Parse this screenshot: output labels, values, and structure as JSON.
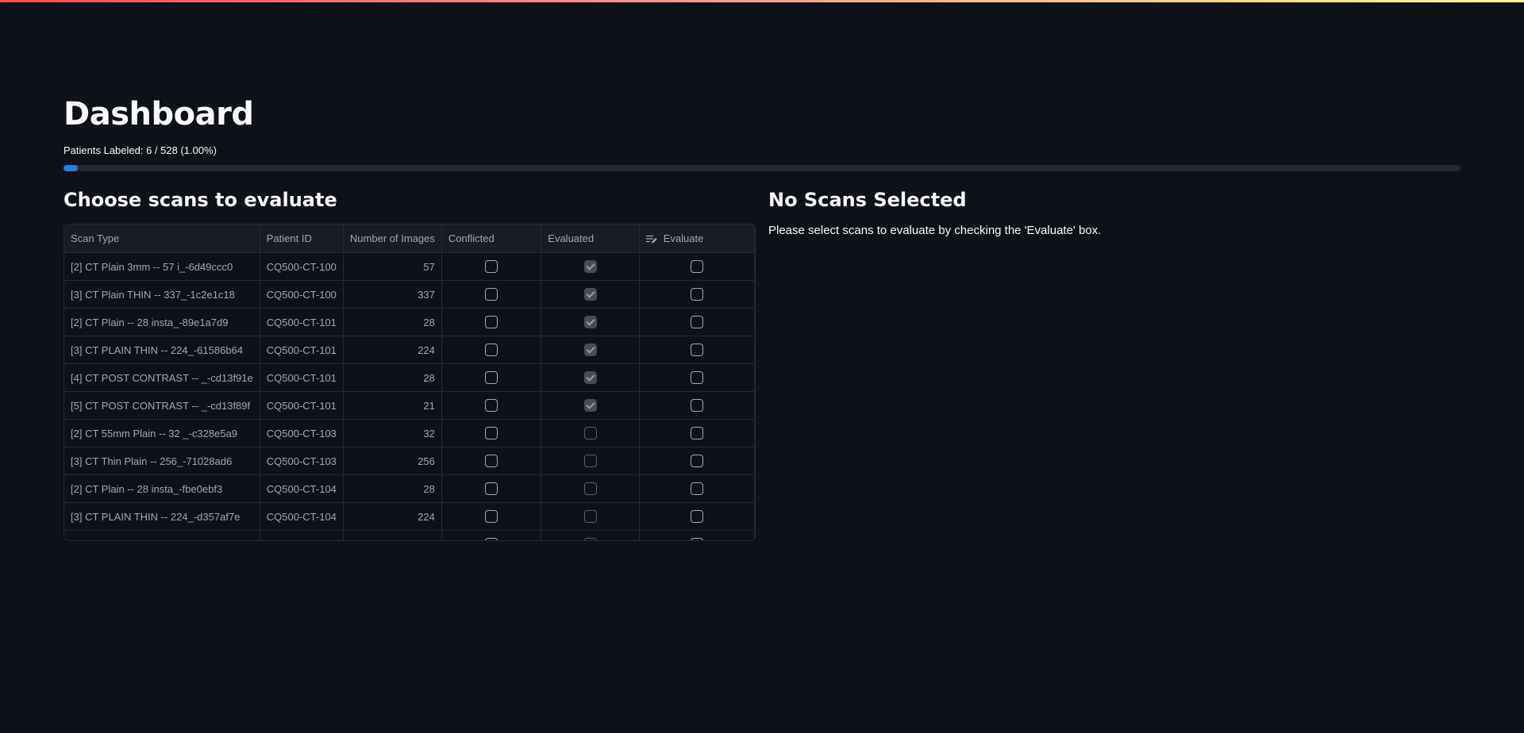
{
  "page": {
    "title": "Dashboard",
    "progress_label": "Patients Labeled: 6 / 528 (1.00%)",
    "progress_fraction": 0.01
  },
  "left": {
    "heading": "Choose scans to evaluate",
    "columns": [
      "Scan Type",
      "Patient ID",
      "Number of Images",
      "Conflicted",
      "Evaluated",
      "Evaluate"
    ],
    "rows": [
      {
        "scan_type": "[2] CT Plain 3mm -- 57 i_-6d49ccc0",
        "patient_id": "CQ500-CT-100",
        "images": "57",
        "conflicted": false,
        "evaluated": true,
        "evaluate": false
      },
      {
        "scan_type": "[3] CT Plain THIN -- 337_-1c2e1c18",
        "patient_id": "CQ500-CT-100",
        "images": "337",
        "conflicted": false,
        "evaluated": true,
        "evaluate": false
      },
      {
        "scan_type": "[2] CT Plain -- 28 insta_-89e1a7d9",
        "patient_id": "CQ500-CT-101",
        "images": "28",
        "conflicted": false,
        "evaluated": true,
        "evaluate": false
      },
      {
        "scan_type": "[3] CT PLAIN THIN -- 224_-61586b64",
        "patient_id": "CQ500-CT-101",
        "images": "224",
        "conflicted": false,
        "evaluated": true,
        "evaluate": false
      },
      {
        "scan_type": "[4] CT POST CONTRAST -- _-cd13f91e",
        "patient_id": "CQ500-CT-101",
        "images": "28",
        "conflicted": false,
        "evaluated": true,
        "evaluate": false
      },
      {
        "scan_type": "[5] CT POST CONTRAST -- _-cd13f89f",
        "patient_id": "CQ500-CT-101",
        "images": "21",
        "conflicted": false,
        "evaluated": true,
        "evaluate": false
      },
      {
        "scan_type": "[2] CT 55mm Plain -- 32 _-c328e5a9",
        "patient_id": "CQ500-CT-103",
        "images": "32",
        "conflicted": false,
        "evaluated": false,
        "evaluate": false
      },
      {
        "scan_type": "[3] CT Thin Plain -- 256_-71028ad6",
        "patient_id": "CQ500-CT-103",
        "images": "256",
        "conflicted": false,
        "evaluated": false,
        "evaluate": false
      },
      {
        "scan_type": "[2] CT Plain -- 28 insta_-fbe0ebf3",
        "patient_id": "CQ500-CT-104",
        "images": "28",
        "conflicted": false,
        "evaluated": false,
        "evaluate": false
      },
      {
        "scan_type": "[3] CT PLAIN THIN -- 224_-d357af7e",
        "patient_id": "CQ500-CT-104",
        "images": "224",
        "conflicted": false,
        "evaluated": false,
        "evaluate": false
      },
      {
        "scan_type": "",
        "patient_id": "",
        "images": "",
        "conflicted": false,
        "evaluated": false,
        "evaluate": false
      }
    ],
    "edit_icon": "edit-column-icon"
  },
  "right": {
    "heading": "No Scans Selected",
    "message": "Please select scans to evaluate by checking the 'Evaluate' box."
  },
  "colors": {
    "background": "#0e1117",
    "progress_fill": "#1c83e1",
    "progress_track": "#262730",
    "header_accent_gradient": [
      "#ff4b4b",
      "#fffd80"
    ]
  }
}
